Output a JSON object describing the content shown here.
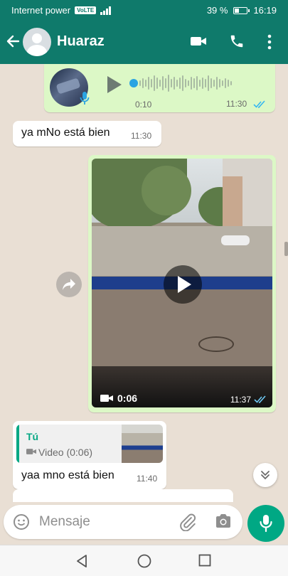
{
  "status_bar": {
    "carrier": "Internet power",
    "network_badge": "VoLTE",
    "battery": "39 %",
    "battery_level": 0.39,
    "clock": "16:19"
  },
  "header": {
    "contact_name": "Huaraz",
    "icons": [
      "back-arrow-icon",
      "avatar",
      "video-call-icon",
      "phone-icon",
      "more-icon"
    ],
    "color": "#0f7a6b"
  },
  "messages": {
    "voice_note": {
      "duration": "0:10",
      "time": "11:30",
      "status": "read"
    },
    "text_1": {
      "text": "ya mNo está bien",
      "time": "11:30"
    },
    "video": {
      "duration": "0:06",
      "time": "11:37",
      "status": "read"
    },
    "reply": {
      "quote_author": "Tú",
      "quote_label": "Video (0:06)",
      "text": "yaa mno está bien",
      "time": "11:40"
    }
  },
  "composer": {
    "placeholder": "Mensaje"
  },
  "colors": {
    "outgoing_bubble": "#dcf8c6",
    "incoming_bubble": "#ffffff",
    "chat_background": "#e9dfd4",
    "accent": "#00a884",
    "read_ticks": "#34b7f1"
  }
}
